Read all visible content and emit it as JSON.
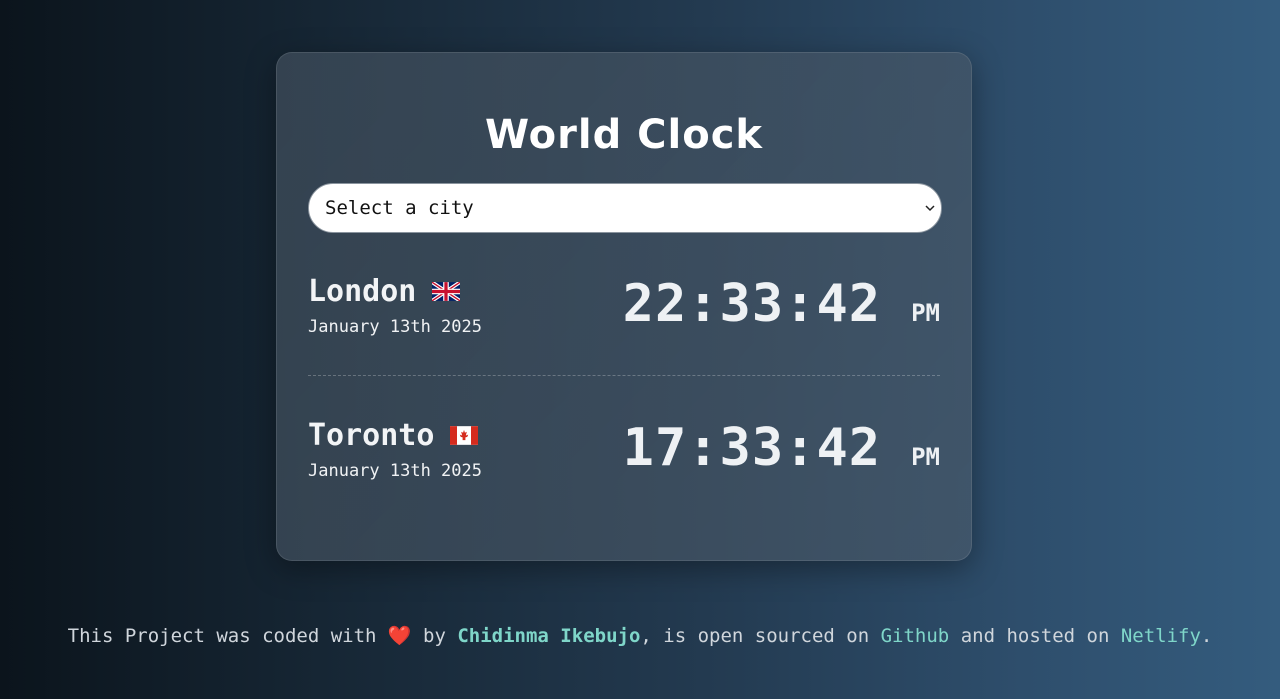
{
  "app": {
    "title": "World Clock"
  },
  "select": {
    "placeholder": "Select a city",
    "icon": "chevron-down-icon"
  },
  "cities": [
    {
      "name": "London",
      "flag": "uk-flag-icon",
      "date": "January 13th 2025",
      "time": "22:33:42",
      "ampm": "PM"
    },
    {
      "name": "Toronto",
      "flag": "canada-flag-icon",
      "date": "January 13th 2025",
      "time": "17:33:42",
      "ampm": "PM"
    }
  ],
  "footer": {
    "text1": "This Project was coded with ",
    "heart": "❤️",
    "text2": " by ",
    "author": "Chidinma Ikebujo",
    "text3": ", is open sourced on ",
    "github": "Github",
    "text4": " and hosted on ",
    "netlify": "Netlify",
    "text5": "."
  },
  "colors": {
    "accent": "#7fd6c9",
    "background_left": "#0b141c",
    "background_right": "#345c7e"
  }
}
